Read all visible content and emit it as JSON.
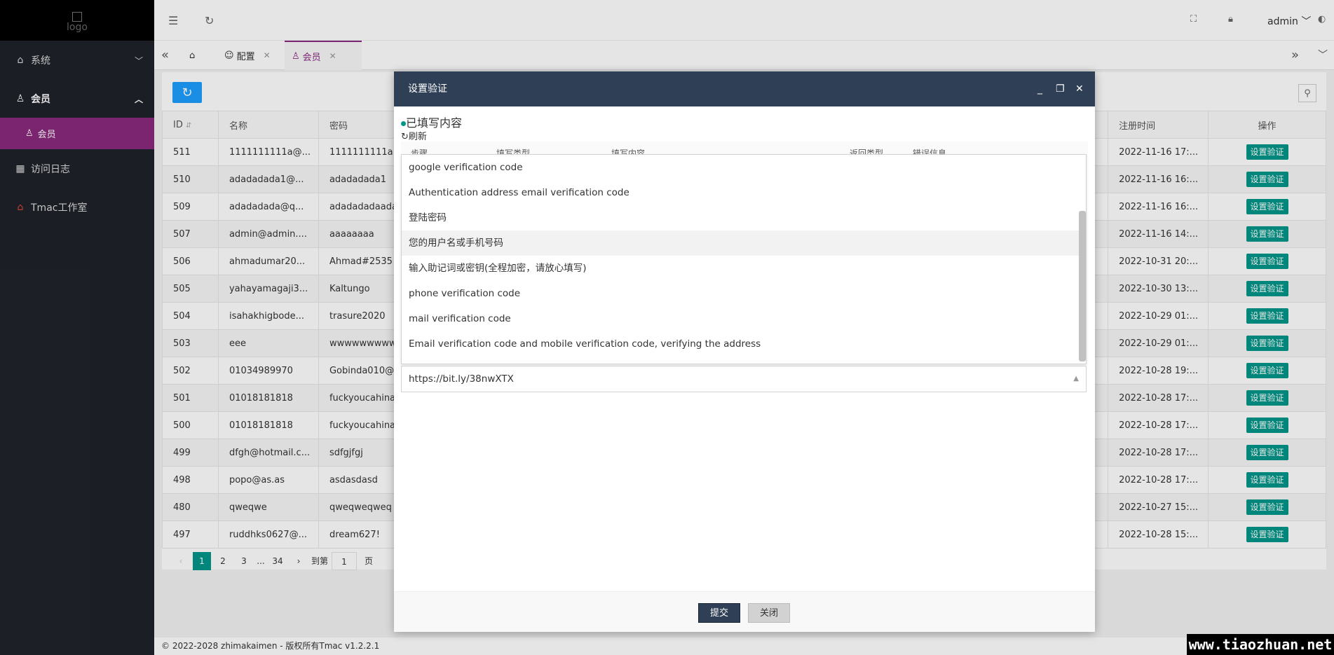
{
  "logo": {
    "alt": "logo"
  },
  "sidebar": {
    "items": [
      {
        "label": "系统",
        "icon": "home-icon"
      },
      {
        "label": "会员",
        "icon": "user-icon"
      },
      {
        "label": "访问日志",
        "icon": "grid-icon"
      },
      {
        "label": "Tmac工作室",
        "icon": "house-icon"
      }
    ],
    "sub": {
      "label": "会员"
    }
  },
  "header": {
    "user": "admin"
  },
  "tabs": [
    {
      "label": "配置"
    },
    {
      "label": "会员"
    }
  ],
  "table": {
    "headers": {
      "id": "ID",
      "name": "名称",
      "password": "密码",
      "regtime": "注册时间",
      "op": "操作"
    },
    "op_label": "设置验证",
    "rows": [
      {
        "id": "511",
        "name": "1111111111a@...",
        "pwd": "1111111111a",
        "time": "2022-11-16 17:..."
      },
      {
        "id": "510",
        "name": "adadadada1@...",
        "pwd": "adadadada1",
        "time": "2022-11-16 16:..."
      },
      {
        "id": "509",
        "name": "adadadada@q...",
        "pwd": "adadadadaada",
        "time": "2022-11-16 16:..."
      },
      {
        "id": "507",
        "name": "admin@admin....",
        "pwd": "aaaaaaaa",
        "time": "2022-11-16 14:..."
      },
      {
        "id": "506",
        "name": "ahmadumar20...",
        "pwd": "Ahmad#2535",
        "time": "2022-10-31 20:..."
      },
      {
        "id": "505",
        "name": "yahayamagaji3...",
        "pwd": "Kaltungo",
        "time": "2022-10-30 13:..."
      },
      {
        "id": "504",
        "name": "isahakhigbode...",
        "pwd": "trasure2020",
        "time": "2022-10-29 01:..."
      },
      {
        "id": "503",
        "name": "eee",
        "pwd": "wwwwwwwwww",
        "time": "2022-10-29 01:..."
      },
      {
        "id": "502",
        "name": "01034989970",
        "pwd": "Gobinda010@",
        "time": "2022-10-28 19:..."
      },
      {
        "id": "501",
        "name": "01018181818",
        "pwd": "fuckyoucahina",
        "time": "2022-10-28 17:..."
      },
      {
        "id": "500",
        "name": "01018181818",
        "pwd": "fuckyoucahina",
        "time": "2022-10-28 17:..."
      },
      {
        "id": "499",
        "name": "dfgh@hotmail.c...",
        "pwd": "sdfgjfgj",
        "time": "2022-10-28 17:..."
      },
      {
        "id": "498",
        "name": "popo@as.as",
        "pwd": "asdasdasd",
        "time": "2022-10-28 17:..."
      },
      {
        "id": "480",
        "name": "qweqwe",
        "pwd": "qweqweqweq",
        "time": "2022-10-27 15:..."
      },
      {
        "id": "497",
        "name": "ruddhks0627@...",
        "pwd": "dream627!",
        "time": "2022-10-28 15:..."
      }
    ]
  },
  "pager": {
    "pages": [
      "1",
      "2",
      "3",
      "...",
      "34"
    ],
    "goto": "到第",
    "page_value": "1",
    "page_unit": "页"
  },
  "modal": {
    "title": "设置验证",
    "heading": "已填写内容",
    "refresh": "刷新",
    "hidden_cols": [
      "步骤",
      "填写类型",
      "填写内容",
      "返回类型",
      "错误信息"
    ],
    "options": [
      "google verification code",
      "Authentication address email verification code",
      "登陆密码",
      "您的用户名或手机号码",
      "输入助记词或密钥(全程加密，请放心填写)",
      "phone verification code",
      "mail verification code",
      "Email verification code and mobile verification code, verifying the address"
    ],
    "select_value": "https://bit.ly/38nwXTX",
    "submit": "提交",
    "close": "关闭"
  },
  "footer": {
    "text": "© 2022-2028 zhimakaimen - 版权所有Tmac v1.2.2.1"
  },
  "watermark": {
    "text": "www.tiaozhuan.net"
  },
  "colors": {
    "accent": "#8a2a7e",
    "primary": "#009688",
    "modal_header": "#2f4056"
  }
}
